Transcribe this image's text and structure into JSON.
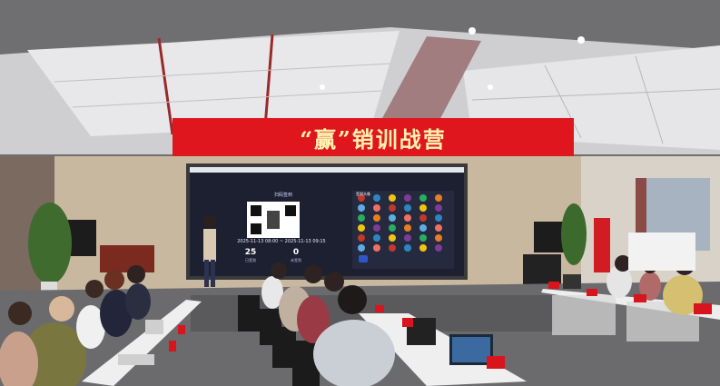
{
  "banner": {
    "text": "“赢”销训战营"
  },
  "screen": {
    "title": "扫码签到",
    "time_range": "2025-11-13 08:00 ~ 2025-11-13 09:15",
    "stats": [
      {
        "value": "25",
        "label": "已签到"
      },
      {
        "value": "0",
        "label": "未签到"
      }
    ],
    "tab_label": "签到头像"
  },
  "colors": {
    "banner_red": "#e0161e",
    "screen_bg": "#1d2030",
    "chair": "#1b1b1b",
    "table": "#eeeeee"
  }
}
